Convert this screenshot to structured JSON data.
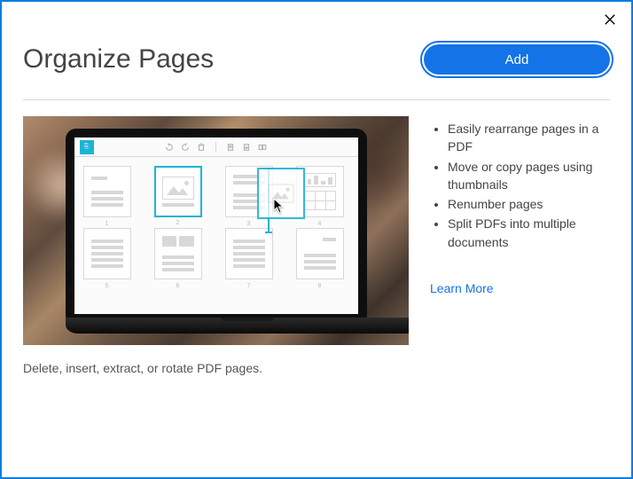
{
  "header": {
    "title": "Organize Pages",
    "add_label": "Add"
  },
  "caption": "Delete, insert, extract, or rotate PDF pages.",
  "features": [
    "Easily rearrange pages in a PDF",
    "Move or copy pages using thumbnails",
    "Renumber pages",
    "Split PDFs into multiple documents"
  ],
  "learn_more_label": "Learn More",
  "colors": {
    "accent": "#1473e6",
    "teal": "#1cb4d4"
  }
}
